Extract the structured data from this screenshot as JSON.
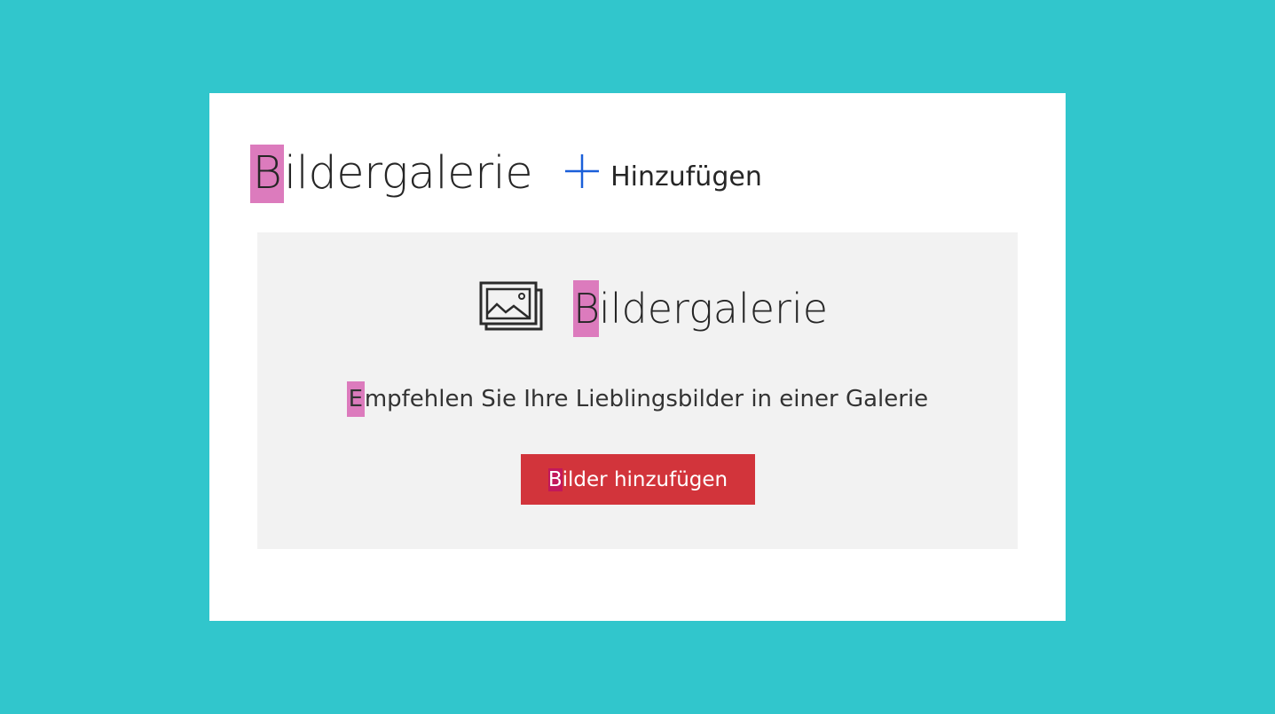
{
  "header": {
    "title_first": "B",
    "title_rest": "ildergalerie",
    "add_label": "Hinzufügen",
    "add_icon": "plus-icon"
  },
  "placeholder": {
    "icon": "image-gallery-icon",
    "title_first": "B",
    "title_rest": "ildergalerie",
    "description_first": "E",
    "description_rest": "mpfehlen Sie Ihre Lieblingsbilder in einer Galerie",
    "button_first": "B",
    "button_rest": "ilder hinzufügen"
  },
  "colors": {
    "background": "#31c6cc",
    "card": "#ffffff",
    "placeholder": "#f2f2f2",
    "button": "#d2343b",
    "highlight": "#dc7bbd",
    "plus_icon": "#1a5fd9"
  }
}
